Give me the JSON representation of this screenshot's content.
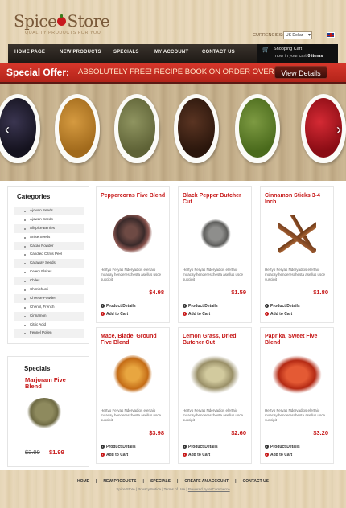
{
  "header": {
    "logo_part1": "Spice",
    "logo_part2": "Store",
    "tagline": "QUALITY PRODUCTS FOR YOU",
    "currency_label": "CURRENCIES:",
    "currency_value": "US Dollar"
  },
  "nav": {
    "items": [
      "HOME PAGE",
      "NEW PRODUCTS",
      "SPECIALS",
      "MY ACCOUNT",
      "CONTACT US"
    ]
  },
  "cart": {
    "title": "Shopping Cart",
    "sub_prefix": "now in your cart",
    "count": "0 items"
  },
  "offer": {
    "title": "Special Offer:",
    "text": "ABSOLUTELY FREE! RECIPE BOOK ON ORDER OVER $20",
    "button": "View Details"
  },
  "slider": {
    "spoon_colors": [
      "#1c1a2a",
      "#b57d2a",
      "#7a7f4e",
      "#3b2418",
      "#5b7a2e",
      "#b0141f"
    ]
  },
  "categories": {
    "title": "Categories",
    "items": [
      "Ajowan Seeds",
      "Ajowan Seeds",
      "Allspice Berries",
      "Anise Seeds",
      "Cacao Powder",
      "Candied Citrus Peel",
      "Caraway Seeds",
      "Celery Flakes",
      "Chiles",
      "Chimichurri",
      "Cheese Powder",
      "Chervil, French",
      "Cinnamon",
      "Citric Acid",
      "Fennel Pollen"
    ]
  },
  "specials": {
    "title": "Specials",
    "name": "Marjoram Five Blend",
    "old_price": "$3.99",
    "new_price": "$1.99"
  },
  "products": [
    {
      "name": "Peppercorns Five Blend",
      "desc": "Hertyo Feryas Nderyadios elertaio moacay hendereschesta asellus usce suscipit",
      "price": "$4.98",
      "color1": "#3a2a2a",
      "color2": "#a8534a"
    },
    {
      "name": "Black Pepper Butcher Cut",
      "desc": "Hertyo Feryas Nderyadios elertaio moacay hendereschesta asellus usce suscipit",
      "price": "$1.59",
      "color1": "#9a9a98",
      "color2": "#5e5e5c"
    },
    {
      "name": "Cinnamon Sticks 3-4 Inch",
      "desc": "Hertyo Feryas Nderyadios elertaio moacay hendereschesta asellus usce suscipit",
      "price": "$1.80",
      "color1": "#9c5a2e",
      "color2": "#6e3a18"
    },
    {
      "name": "Mace, Blade, Ground Five Blend",
      "desc": "Hertyo Feryas Nderyadios elertaio moacay hendereschesta asellus usce suscipit",
      "price": "$3.98",
      "color1": "#e0962e",
      "color2": "#c46c16"
    },
    {
      "name": "Lemon Grass, Dried Butcher Cut",
      "desc": "Hertyo Feryas Nderyadios elertaio moacay hendereschesta asellus usce suscipit",
      "price": "$2.60",
      "color1": "#c8bf96",
      "color2": "#8f8660"
    },
    {
      "name": "Paprika, Sweet Five Blend",
      "desc": "Hertyo Feryas Nderyadios elertaio moacay hendereschesta asellus usce suscipit",
      "price": "$3.20",
      "color1": "#d84a2a",
      "color2": "#a82612"
    }
  ],
  "card_links": {
    "details": "Product Details",
    "cart": "Add to Cart"
  },
  "footer": {
    "links": [
      "HOME",
      "NEW PRODUCTS",
      "SPECIALS",
      "CREATE AN ACCOUNT",
      "CONTACT US"
    ],
    "store": "Spice Store",
    "privacy": "Privacy Notice",
    "terms": "Terms of Use",
    "powered": "Powered by osCommerce"
  }
}
